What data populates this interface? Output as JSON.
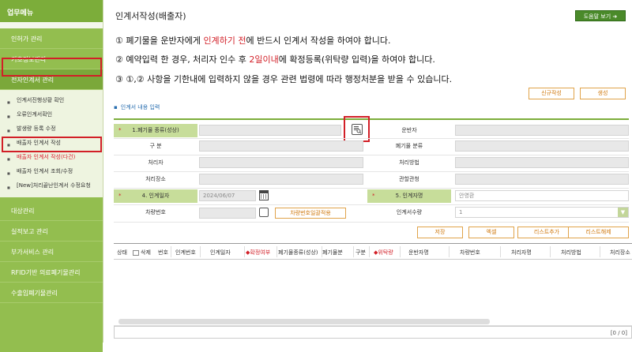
{
  "sidebar": {
    "header": "업무메뉴",
    "items": [
      {
        "label": "인허가 관리"
      },
      {
        "label": "기초정보관리"
      },
      {
        "label": "전자인계서 관리"
      }
    ],
    "submenu": [
      {
        "label": "인계서진행상황 확인"
      },
      {
        "label": "오류인계서확인"
      },
      {
        "label": "발생량 등록 수정"
      },
      {
        "label": "배출자 인계서 작성"
      },
      {
        "label": "배출자 인계서 작성(다건)"
      },
      {
        "label": "배출자 인계서 조회/수정"
      },
      {
        "label": "[New]처리끝난인계서 수정요청"
      }
    ],
    "items_after": [
      {
        "label": "대상관리"
      },
      {
        "label": "실적보고 관리"
      },
      {
        "label": "부가서비스 관리"
      },
      {
        "label": "RFID기반 의료폐기물관리"
      },
      {
        "label": "수출입폐기물관리"
      }
    ]
  },
  "main": {
    "title": "인계서작성(배출자)",
    "help_button": "도움말 보기",
    "notice1_a": "① 폐기물을 운반자에게 ",
    "notice1_red": "인계하기 전",
    "notice1_b": "에 반드시 인계서 작성을 하여야 합니다.",
    "notice2_a": "② 예약입력 한 경우, 처리자 인수 후 ",
    "notice2_red": "2일이내",
    "notice2_b": "에 확정등록(위탁량 입력)을 하여야 합니다.",
    "notice3": "③ ①,② 사항을 기한내에 입력하지 않을 경우 관련 법령에 따라 행정처분을 받을 수 있습니다.",
    "new_button": "신규작성",
    "save_button": "생성",
    "section_title": "인계서 내용 입력"
  },
  "form": {
    "waste_type_label": "1.폐기물 종류(성상)",
    "carrier_label": "운반자",
    "category_label": "구 분",
    "waste_class_label": "폐기물 분류",
    "processor_label": "처리자",
    "process_method_label": "처리방법",
    "process_place_label": "처리장소",
    "authority_label": "관할관청",
    "handover_date_label": "4. 인계일자",
    "handover_date_value": "2024/06/07",
    "handover_person_label": "5. 인계자명",
    "handover_person_value": "안영환",
    "vehicle_label": "차량번호",
    "vehicle_batch_button": "차량번호일괄적용",
    "handover_qty_label": "인계서수량",
    "handover_qty_value": "1"
  },
  "list_buttons": {
    "save": "저장",
    "excel": "엑셀",
    "list_add": "리스트추가",
    "list_clear": "리스트해제"
  },
  "table": {
    "headers": [
      "상태",
      "삭제",
      "번호",
      "인계번호",
      "인계일자",
      "◆확정여부",
      "폐기물종류(성상)",
      "폐기물분",
      "구분",
      "◆위탁량",
      "운반자명",
      "차량번호",
      "처리자명",
      "처리방법",
      "처리장소"
    ],
    "pager": "[0 / 0]"
  }
}
